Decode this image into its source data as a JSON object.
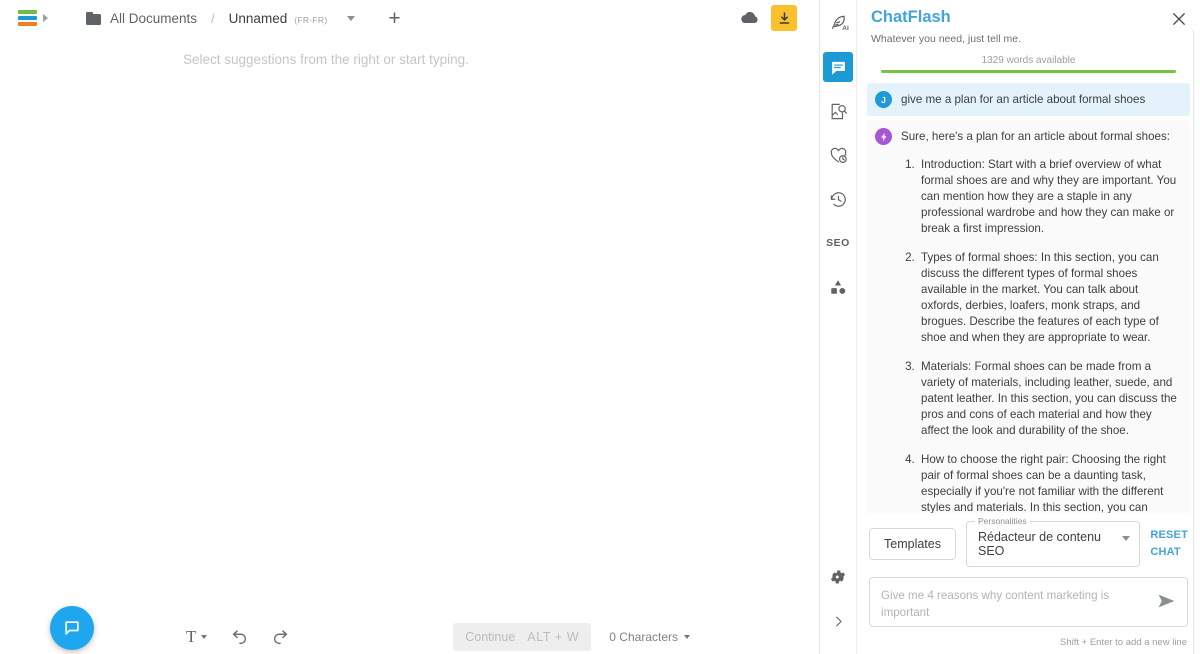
{
  "topbar": {
    "logo_name": "app-logo",
    "breadcrumb": {
      "folder": "All Documents",
      "separator": "/",
      "document": "Unnamed",
      "language": "(FR-FR)"
    },
    "add_label": "+",
    "cloud_icon": "cloud-icon",
    "download_icon": "download-icon",
    "download_bg": "#fbc02d"
  },
  "editor": {
    "placeholder": "Select suggestions from the right or start typing.",
    "fab_icon": "chat-bubble-icon",
    "fab_color": "#1ea7ef",
    "toolbar": {
      "text_style_label": "T",
      "undo_icon": "undo-icon",
      "redo_icon": "redo-icon",
      "continue_label": "Continue",
      "continue_shortcut": "ALT + W",
      "character_count": "0 Characters"
    }
  },
  "rail": {
    "items": [
      {
        "name": "feather-ai-icon",
        "label": "AI",
        "active": false
      },
      {
        "name": "chat-icon",
        "label": "",
        "active": true
      },
      {
        "name": "image-search-icon",
        "label": "",
        "active": false
      },
      {
        "name": "heart-clock-icon",
        "label": "",
        "active": false
      },
      {
        "name": "history-icon",
        "label": "",
        "active": false
      },
      {
        "name": "seo-icon",
        "label": "SEO",
        "active": false
      },
      {
        "name": "shapes-icon",
        "label": "",
        "active": false
      }
    ],
    "bottom": [
      {
        "name": "settings-gear-icon"
      },
      {
        "name": "chevron-right-icon"
      }
    ]
  },
  "chat": {
    "title": "ChatFlash",
    "title_color": "#42a5d9",
    "subtitle": "Whatever you need, just tell me.",
    "close_icon": "close-icon",
    "words_available": "1329 words available",
    "progress_color": "#76c442",
    "progress_percent": 100,
    "messages": [
      {
        "role": "user",
        "avatar_initial": "J",
        "avatar_color": "#1e9ad6",
        "text": "give me a plan for an article about formal shoes",
        "bg": "#e3f2fb"
      },
      {
        "role": "assistant",
        "avatar_icon": "lightning-bolt-icon",
        "avatar_color": "#a855d6",
        "bg": "#fafafa",
        "intro": "Sure, here's a plan for an article about formal shoes:",
        "items": [
          "Introduction: Start with a brief overview of what formal shoes are and why they are important. You can mention how they are a staple in any professional wardrobe and how they can make or break a first impression.",
          "Types of formal shoes: In this section, you can discuss the different types of formal shoes available in the market. You can talk about oxfords, derbies, loafers, monk straps, and brogues. Describe the features of each type of shoe and when they are appropriate to wear.",
          "Materials: Formal shoes can be made from a variety of materials, including leather, suede, and patent leather. In this section, you can discuss the pros and cons of each material and how they affect the look and durability of the shoe.",
          "How to choose the right pair: Choosing the right pair of formal shoes can be a daunting task, especially if you're not familiar with the different styles and materials. In this section, you can provide tips on how to choose the right pair of formal shoes based on your personal style, foot shape, and budget."
        ]
      }
    ],
    "controls": {
      "templates_label": "Templates",
      "personalities_legend": "Personalities",
      "personality_selected": "Rédacteur de contenu SEO",
      "reset_line1": "RESET",
      "reset_line2": "CHAT",
      "reset_color": "#42a5d9"
    },
    "input": {
      "placeholder": "Give me 4 reasons why content marketing is important",
      "value": "",
      "send_icon": "send-icon",
      "hint": "Shift + Enter to add a new line"
    }
  }
}
